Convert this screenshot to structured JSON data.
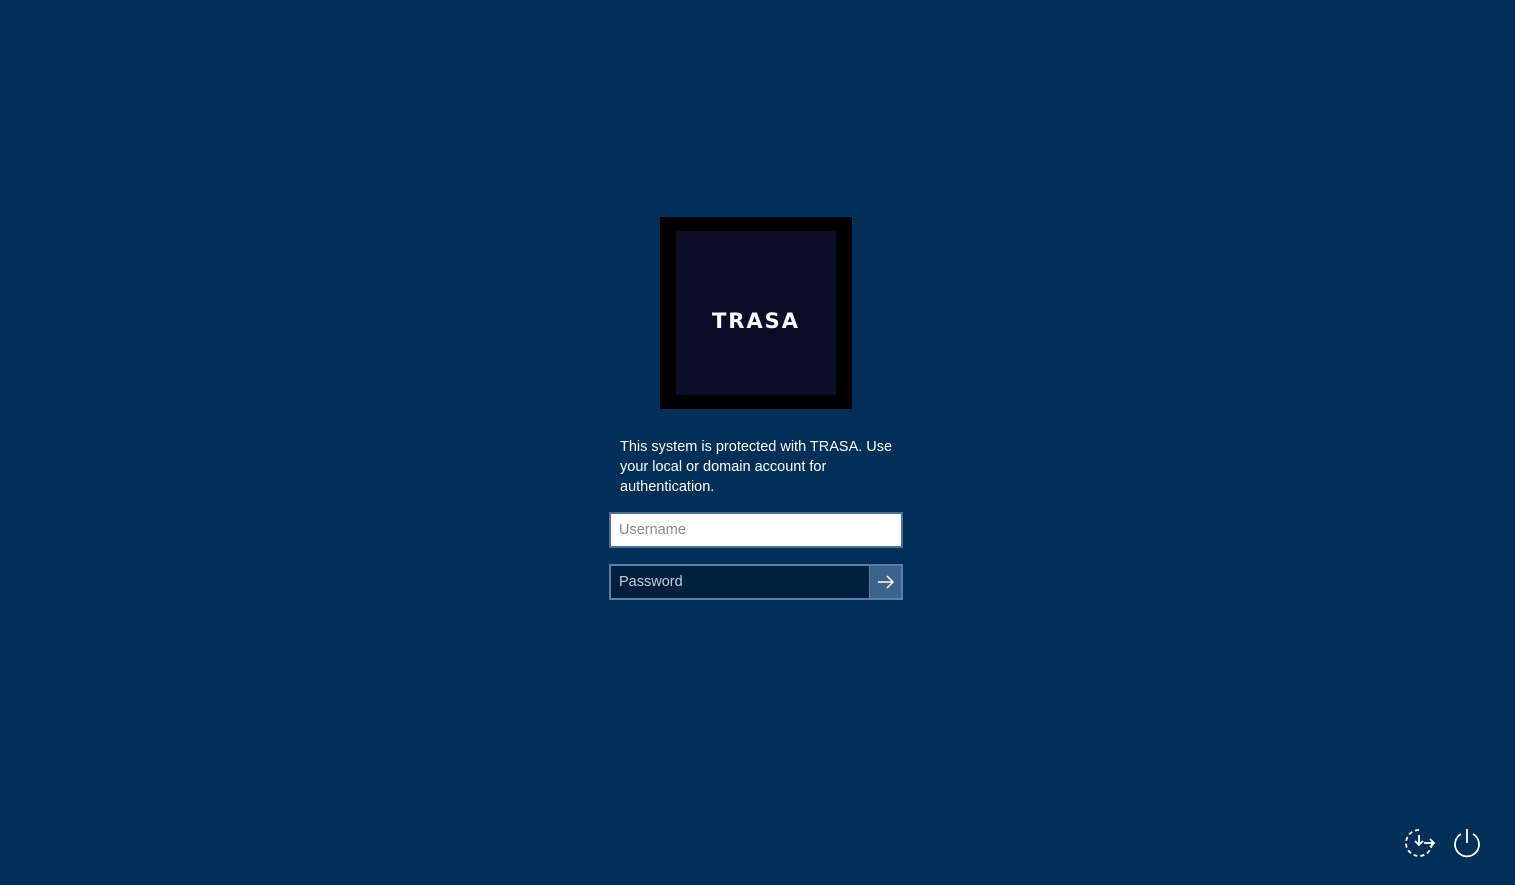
{
  "logo": {
    "text": "TRASA",
    "tile_color": "#000000",
    "inner_color": "#0a0d27"
  },
  "message": "This system is protected with TRASA. Use your local or domain account for authentication.",
  "username": {
    "value": "",
    "placeholder": "Username"
  },
  "password": {
    "value": "",
    "placeholder": "Password"
  },
  "submit": {
    "icon": "arrow-right-icon"
  },
  "corner_buttons": {
    "ease_of_access_icon": "ease-of-access-icon",
    "power_icon": "power-icon"
  },
  "colors": {
    "background": "#003057",
    "submit_button": "#3b6289"
  }
}
